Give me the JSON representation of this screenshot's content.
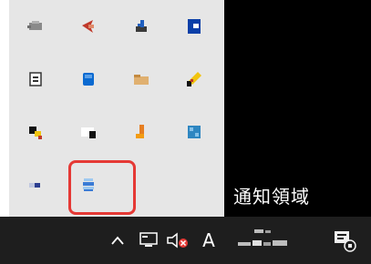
{
  "overflow_panel": {
    "area_label": "通知領域",
    "icons": [
      {
        "name": "tray-app-grey-icon",
        "colors": [
          "#8a8a8a",
          "#b0b0b0"
        ]
      },
      {
        "name": "tray-app-red-arrow-icon",
        "colors": [
          "#c0392b",
          "#e08a6a"
        ]
      },
      {
        "name": "tray-app-bluetooth-like-icon",
        "colors": [
          "#1f5fbf",
          "#3a3a3a"
        ]
      },
      {
        "name": "tray-app-blue-square-icon",
        "colors": [
          "#0a3fa8",
          "#ffffff"
        ]
      },
      {
        "name": "tray-app-white-box-icon",
        "colors": [
          "#ffffff",
          "#333333"
        ]
      },
      {
        "name": "tray-app-onedrive-icon",
        "colors": [
          "#0b6ad1",
          "#5ca0e8"
        ]
      },
      {
        "name": "tray-app-folder-icon",
        "colors": [
          "#e0b070",
          "#c48a40"
        ]
      },
      {
        "name": "tray-app-yellow-black-icon",
        "colors": [
          "#f1c40f",
          "#111111"
        ]
      },
      {
        "name": "tray-app-yellow-black-red-icon",
        "colors": [
          "#111111",
          "#f1c40f"
        ]
      },
      {
        "name": "tray-app-white-black-icon",
        "colors": [
          "#ffffff",
          "#111111"
        ]
      },
      {
        "name": "tray-app-orange-key-icon",
        "colors": [
          "#e67e22",
          "#f39c12"
        ]
      },
      {
        "name": "tray-app-blue-grid-icon",
        "colors": [
          "#2e86c1",
          "#85c1e9"
        ]
      },
      {
        "name": "tray-app-small-blue-icon",
        "colors": [
          "#2c3e90",
          "#bfc7e0"
        ]
      },
      {
        "name": "tray-app-highlighted-stack-icon",
        "colors": [
          "#3a7bd5",
          "#9ec9f0"
        ]
      }
    ]
  },
  "taskbar": {
    "ime_mode": "A",
    "icons": {
      "chevron": "chevron-up-icon",
      "network": "network-icon",
      "volume": "volume-muted-icon",
      "clock": "clock-icon",
      "notification": "notification-icon"
    }
  },
  "colors": {
    "highlight": "#e53935",
    "panel_bg": "#e6e6e6",
    "taskbar_bg": "#1e1e1e"
  }
}
